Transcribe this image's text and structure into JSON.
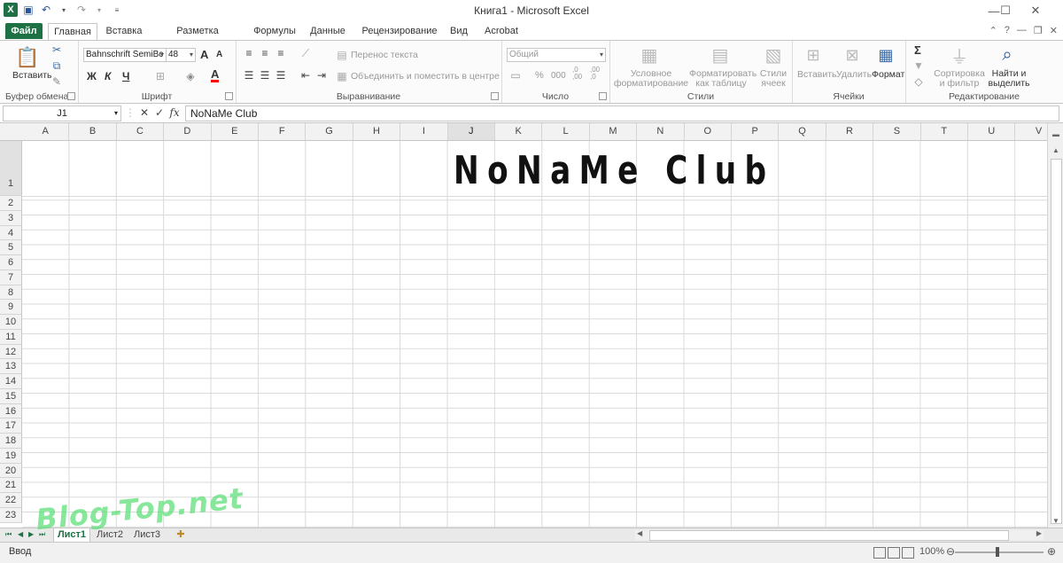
{
  "window": {
    "title": "Книга1 - Microsoft Excel",
    "minimize_icon": "minimize-icon",
    "maximize_icon": "maximize-icon",
    "close_icon": "close-icon"
  },
  "quick_access": {
    "logo": "X",
    "save_icon": "save-icon",
    "undo_icon": "undo-icon",
    "redo_icon": "redo-icon"
  },
  "tabs": [
    {
      "label": "Файл"
    },
    {
      "label": "Главная"
    },
    {
      "label": "Вставка"
    },
    {
      "label": "Разметка страницы"
    },
    {
      "label": "Формулы"
    },
    {
      "label": "Данные"
    },
    {
      "label": "Рецензирование"
    },
    {
      "label": "Вид"
    },
    {
      "label": "Acrobat"
    }
  ],
  "ribbon": {
    "clipboard": {
      "label": "Буфер обмена",
      "paste": "Вставить"
    },
    "font": {
      "label": "Шрифт",
      "font_name": "Bahnschrift SemiBc",
      "font_size": "48",
      "bold": "Ж",
      "italic": "К",
      "underline": "Ч",
      "font_color_letter": "A",
      "grow": "A",
      "shrink": "A",
      "font_color": "#ff0000"
    },
    "alignment": {
      "label": "Выравнивание",
      "wrap_text": "Перенос текста",
      "merge_center": "Объединить и поместить в центре"
    },
    "number": {
      "label": "Число",
      "format": "Общий",
      "percent": "%",
      "thousands": "000",
      "inc_decimal": ",0\n,00",
      "dec_decimal": ",00\n,0"
    },
    "styles": {
      "label": "Стили",
      "conditional": "Условное\nформатирование",
      "as_table": "Форматировать\nкак таблицу",
      "cell_styles": "Стили\nячеек"
    },
    "cells": {
      "label": "Ячейки",
      "insert": "Вставить",
      "delete": "Удалить",
      "format": "Формат"
    },
    "editing": {
      "label": "Редактирование",
      "sort_filter": "Сортировка\nи фильтр",
      "find_select": "Найти и\nвыделить",
      "sum": "Σ"
    }
  },
  "formula_bar": {
    "name_box": "J1",
    "cancel": "✕",
    "enter": "✓",
    "fx": "fx",
    "content": "NoNaMe Club"
  },
  "grid": {
    "columns": [
      "A",
      "B",
      "C",
      "D",
      "E",
      "F",
      "G",
      "H",
      "I",
      "J",
      "K",
      "L",
      "M",
      "N",
      "O",
      "P",
      "Q",
      "R",
      "S",
      "T",
      "U",
      "V"
    ],
    "rows": [
      "1",
      "2",
      "3",
      "4",
      "5",
      "6",
      "7",
      "8",
      "9",
      "10",
      "11",
      "12",
      "13",
      "14",
      "15",
      "16",
      "17",
      "18",
      "19",
      "20",
      "21",
      "22",
      "23"
    ],
    "selected_cell": "J1",
    "cell_j1": "NoNaMe Club"
  },
  "sheets": [
    "Лист1",
    "Лист2",
    "Лист3"
  ],
  "status": {
    "mode": "Ввод",
    "zoom": "100%"
  },
  "watermark": "Blog-Top.net"
}
